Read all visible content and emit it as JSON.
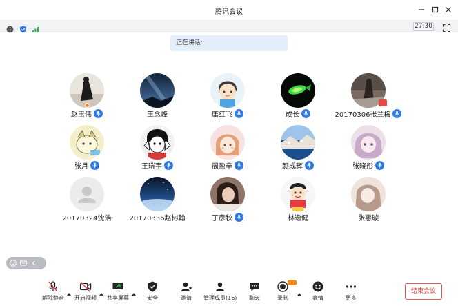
{
  "window": {
    "title": "腾讯会议"
  },
  "status": {
    "timer": "27:30"
  },
  "banner": {
    "speaking_label": "正在讲话:"
  },
  "participants": [
    {
      "name": "赵玉伟"
    },
    {
      "name": "王念峰"
    },
    {
      "name": "庸红飞"
    },
    {
      "name": "成长"
    },
    {
      "name": "20170306张兰梅"
    },
    {
      "name": "张月"
    },
    {
      "name": "王瑞宇"
    },
    {
      "name": "周盈辛"
    },
    {
      "name": "颜成辉"
    },
    {
      "name": "张晓彤"
    },
    {
      "name": "20170324沈浩"
    },
    {
      "name": "20170336赵彬翰"
    },
    {
      "name": "丁彦秋"
    },
    {
      "name": "林逸健"
    },
    {
      "name": "张惠璇"
    }
  ],
  "toolbar": {
    "unmute": "解除静音",
    "start_video": "开启视频",
    "share_screen": "共享屏幕",
    "security": "安全",
    "invite": "邀请",
    "manage_members": "管理成员(16)",
    "chat": "聊天",
    "record": "录制",
    "reactions": "表情",
    "more": "更多",
    "end_meeting": "结束会议"
  },
  "colors": {
    "accent": "#2f7ae5",
    "end_red": "#e04545",
    "banner_bg": "#e4eefb"
  }
}
